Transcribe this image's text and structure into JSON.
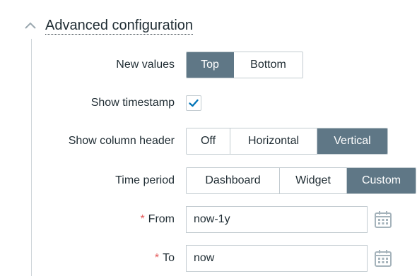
{
  "section": {
    "title": "Advanced configuration",
    "icon": "chevron-up-icon"
  },
  "fields": {
    "new_values": {
      "label": "New values",
      "options": [
        "Top",
        "Bottom"
      ],
      "selected": "Top"
    },
    "show_timestamp": {
      "label": "Show timestamp",
      "checked": true
    },
    "show_column_header": {
      "label": "Show column header",
      "options": [
        "Off",
        "Horizontal",
        "Vertical"
      ],
      "selected": "Vertical"
    },
    "time_period": {
      "label": "Time period",
      "options": [
        "Dashboard",
        "Widget",
        "Custom"
      ],
      "selected": "Custom"
    },
    "from": {
      "required_mark": "*",
      "label": "From",
      "value": "now-1y",
      "icon": "calendar-icon"
    },
    "to": {
      "required_mark": "*",
      "label": "To",
      "value": "now",
      "icon": "calendar-icon"
    }
  },
  "colors": {
    "active_segment": "#5f7786",
    "border": "#c2cbd0",
    "checkmark": "#0275b8",
    "required": "#e45959",
    "calendar_icon": "#a5b3bb"
  }
}
